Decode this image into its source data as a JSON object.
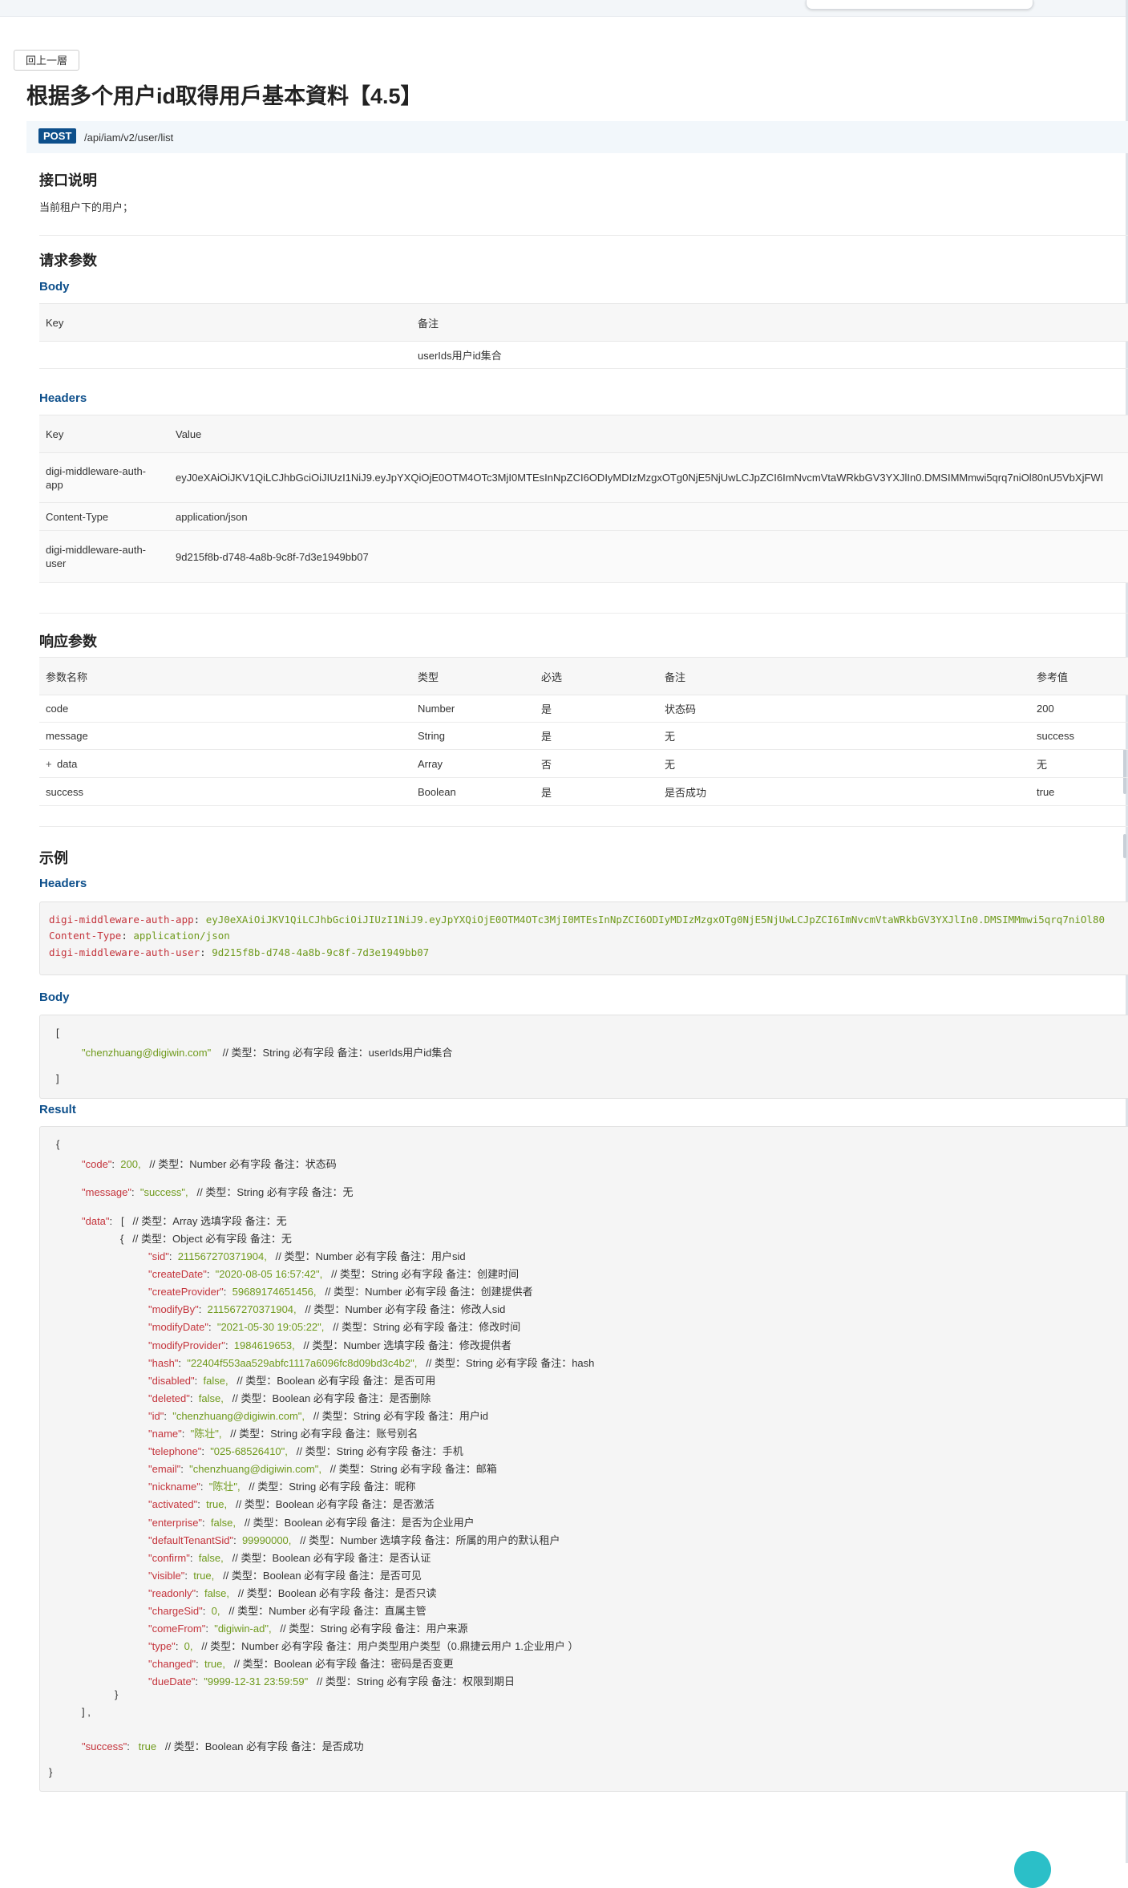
{
  "back_label": "回上一層",
  "title": "根据多个用户id取得用戶基本資料【4.5】",
  "api": {
    "method": "POST",
    "path": "/api/iam/v2/user/list"
  },
  "intro": {
    "heading": "接口说明",
    "text": "当前租户下的用户；"
  },
  "request": {
    "heading": "请求参数",
    "body_label": "Body",
    "body_table": {
      "headers": [
        "Key",
        "备注"
      ],
      "rows": [
        [
          "",
          "userIds用户id集合"
        ]
      ]
    },
    "headers_label": "Headers",
    "headers_table": {
      "headers": [
        "Key",
        "Value"
      ],
      "rows": [
        [
          "digi-middleware-auth-app",
          "eyJ0eXAiOiJKV1QiLCJhbGciOiJIUzI1NiJ9.eyJpYXQiOjE0OTM4OTc3MjI0MTEsInNpZCI6ODIyMDIzMzgxOTg0NjE5NjUwLCJpZCI6ImNvcmVtaWRkbGV3YXJlIn0.DMSIMMmwi5qrq7niOl80nU5VbXjFWI"
        ],
        [
          "Content-Type",
          "application/json"
        ],
        [
          "digi-middleware-auth-user",
          "9d215f8b-d748-4a8b-9c8f-7d3e1949bb07"
        ]
      ]
    }
  },
  "response": {
    "heading": "响应参数",
    "table": {
      "headers": [
        "参数名称",
        "类型",
        "必选",
        "备注",
        "参考值"
      ],
      "rows": [
        [
          "code",
          "Number",
          "是",
          "状态码",
          "200"
        ],
        [
          "data",
          "Array",
          "否",
          "无",
          "无"
        ],
        [
          "message",
          "String",
          "是",
          "无",
          "success"
        ],
        [
          "success",
          "Boolean",
          "是",
          "是否成功",
          "true"
        ]
      ],
      "expand_symbol": "+"
    }
  },
  "example": {
    "heading": "示例",
    "headers_label": "Headers",
    "headers_lines": [
      {
        "key": "digi-middleware-auth-app",
        "value": "eyJ0eXAiOiJKV1QiLCJhbGciOiJIUzI1NiJ9.eyJpYXQiOjE0OTM4OTc3MjI0MTEsInNpZCI6ODIyMDIzMzgxOTg0NjE5NjUwLCJpZCI6ImNvcmVtaWRkbGV3YXJlIn0.DMSIMMmwi5qrq7niOl80"
      },
      {
        "key": "Content-Type",
        "value": "application/json"
      },
      {
        "key": "digi-middleware-auth-user",
        "value": "9d215f8b-d748-4a8b-9c8f-7d3e1949bb07"
      }
    ],
    "body_label": "Body",
    "body": {
      "open": "[",
      "item_value": "\"chenzhuang@digiwin.com\"",
      "item_comment": "// 类型：String  必有字段  备注：userIds用户id集合",
      "close": "]"
    },
    "result_label": "Result",
    "result": {
      "open": "{",
      "close": "}",
      "code": {
        "key": "\"code\"",
        "value": "200,",
        "comment": "// 类型：Number  必有字段  备注：状态码"
      },
      "message": {
        "key": "\"message\"",
        "value": "\"success\",",
        "comment": "// 类型：String  必有字段  备注：无"
      },
      "data": {
        "key": "\"data\"",
        "bracket": "[",
        "comment": "// 类型：Array  选填字段  备注：无"
      },
      "object_open": {
        "brace": "{",
        "comment": "// 类型：Object  必有字段  备注：无"
      },
      "fields": [
        {
          "key": "\"sid\"",
          "value": "211567270371904,",
          "comment": "// 类型：Number  必有字段  备注：用户sid"
        },
        {
          "key": "\"createDate\"",
          "value": "\"2020-08-05 16:57:42\",",
          "comment": "// 类型：String  必有字段  备注：创建时间"
        },
        {
          "key": "\"createProvider\"",
          "value": "59689174651456,",
          "comment": "// 类型：Number  必有字段  备注：创建提供者"
        },
        {
          "key": "\"modifyBy\"",
          "value": "211567270371904,",
          "comment": "// 类型：Number  必有字段  备注：修改人sid"
        },
        {
          "key": "\"modifyDate\"",
          "value": "\"2021-05-30 19:05:22\",",
          "comment": "// 类型：String  必有字段  备注：修改时间"
        },
        {
          "key": "\"modifyProvider\"",
          "value": "1984619653,",
          "comment": "// 类型：Number  选填字段  备注：修改提供者"
        },
        {
          "key": "\"hash\"",
          "value": "\"22404f553aa529abfc1117a6096fc8d09bd3c4b2\",",
          "comment": "// 类型：String  必有字段  备注：hash"
        },
        {
          "key": "\"disabled\"",
          "value": "false,",
          "comment": "// 类型：Boolean  必有字段  备注：是否可用"
        },
        {
          "key": "\"deleted\"",
          "value": "false,",
          "comment": "// 类型：Boolean  必有字段  备注：是否删除"
        },
        {
          "key": "\"id\"",
          "value": "\"chenzhuang@digiwin.com\",",
          "comment": "// 类型：String  必有字段  备注：用户id"
        },
        {
          "key": "\"name\"",
          "value": "\"陈壮\",",
          "comment": "// 类型：String  必有字段  备注：账号别名"
        },
        {
          "key": "\"telephone\"",
          "value": "\"025-68526410\",",
          "comment": "// 类型：String  必有字段  备注：手机"
        },
        {
          "key": "\"email\"",
          "value": "\"chenzhuang@digiwin.com\",",
          "comment": "// 类型：String  必有字段  备注：邮箱"
        },
        {
          "key": "\"nickname\"",
          "value": "\"陈壮\",",
          "comment": "// 类型：String  必有字段  备注：昵称"
        },
        {
          "key": "\"activated\"",
          "value": "true,",
          "comment": "// 类型：Boolean  必有字段  备注：是否激活"
        },
        {
          "key": "\"enterprise\"",
          "value": "false,",
          "comment": "// 类型：Boolean  必有字段  备注：是否为企业用户"
        },
        {
          "key": "\"defaultTenantSid\"",
          "value": "99990000,",
          "comment": "// 类型：Number  选填字段  备注：所属的用户的默认租户"
        },
        {
          "key": "\"confirm\"",
          "value": "false,",
          "comment": "// 类型：Boolean  必有字段  备注：是否认证"
        },
        {
          "key": "\"visible\"",
          "value": "true,",
          "comment": "// 类型：Boolean  必有字段  备注：是否可见"
        },
        {
          "key": "\"readonly\"",
          "value": "false,",
          "comment": "// 类型：Boolean  必有字段  备注：是否只读"
        },
        {
          "key": "\"chargeSid\"",
          "value": "0,",
          "comment": "// 类型：Number  必有字段  备注：直属主管"
        },
        {
          "key": "\"comeFrom\"",
          "value": "\"digiwin-ad\",",
          "comment": "// 类型：String  必有字段  备注：用户来源"
        },
        {
          "key": "\"type\"",
          "value": "0,",
          "comment": "// 类型：Number  必有字段  备注：用户类型用户类型（0.鼎捷云用户 1.企业用户 ）"
        },
        {
          "key": "\"changed\"",
          "value": "true,",
          "comment": "// 类型：Boolean  必有字段  备注：密码是否变更"
        },
        {
          "key": "\"dueDate\"",
          "value": "\"9999-12-31 23:59:59\"",
          "comment": "// 类型：String  必有字段  备注：权限到期日"
        }
      ],
      "object_close": "}",
      "data_close": "] ,",
      "success": {
        "key": "\"success\"",
        "value": "true",
        "comment": "// 类型：Boolean  必有字段  备注：是否成功"
      }
    }
  }
}
